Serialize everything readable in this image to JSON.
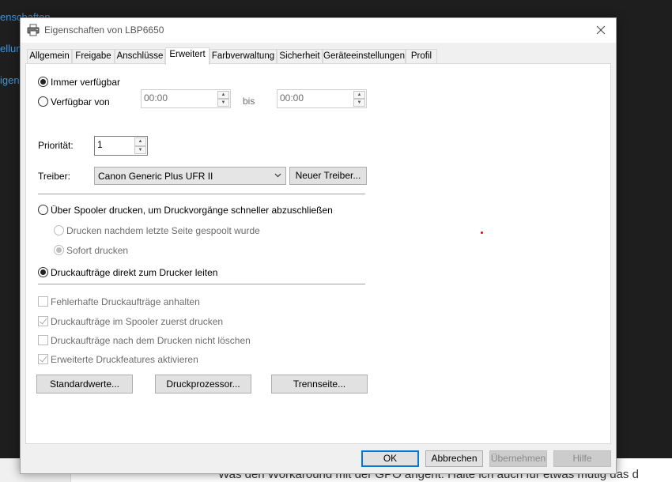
{
  "background": {
    "sidebar_links": [
      "enschaften",
      "ellun",
      "igen"
    ],
    "bottom_text": "Was den Workaround mit der GPO angeht: Halte ich auch für etwas mutig das d"
  },
  "window": {
    "title": "Eigenschaften von LBP6650",
    "icon": "printer-icon"
  },
  "tabs": [
    {
      "label": "Allgemein"
    },
    {
      "label": "Freigabe"
    },
    {
      "label": "Anschlüsse"
    },
    {
      "label": "Erweitert"
    },
    {
      "label": "Farbverwaltung"
    },
    {
      "label": "Sicherheit"
    },
    {
      "label": "Geräteeinstellungen"
    },
    {
      "label": "Profil"
    }
  ],
  "active_tab": "Erweitert",
  "availability": {
    "always_label": "Immer verfügbar",
    "always_selected": true,
    "from_label": "Verfügbar von",
    "from_time": "00:00",
    "until_label": "bis",
    "until_time": "00:00"
  },
  "priority": {
    "label": "Priorität:",
    "value": "1"
  },
  "driver": {
    "label": "Treiber:",
    "selected": "Canon Generic Plus UFR II",
    "new_driver_button": "Neuer Treiber..."
  },
  "spooling": {
    "spool_label": "Über Spooler drucken, um Druckvorgänge schneller abzuschließen",
    "spool_selected": false,
    "after_last_page_label": "Drucken nachdem letzte Seite gespoolt wurde",
    "after_last_page_selected": false,
    "immediately_label": "Sofort drucken",
    "immediately_selected": true,
    "direct_label": "Druckaufträge direkt zum Drucker leiten",
    "direct_selected": true
  },
  "options": [
    {
      "label": "Fehlerhafte Druckaufträge anhalten",
      "checked": false
    },
    {
      "label": "Druckaufträge im Spooler zuerst drucken",
      "checked": true
    },
    {
      "label": "Druckaufträge nach dem Drucken nicht löschen",
      "checked": false
    },
    {
      "label": "Erweiterte Druckfeatures aktivieren",
      "checked": true
    }
  ],
  "panel_buttons": {
    "defaults": "Standardwerte...",
    "print_processor": "Druckprozessor...",
    "separator_page": "Trennseite..."
  },
  "dialog_buttons": {
    "ok": "OK",
    "cancel": "Abbrechen",
    "apply": "Übernehmen",
    "help": "Hilfe"
  },
  "colors": {
    "accent": "#0078d7",
    "link": "#3a96dd",
    "disabled_text": "#6d6d6d"
  }
}
